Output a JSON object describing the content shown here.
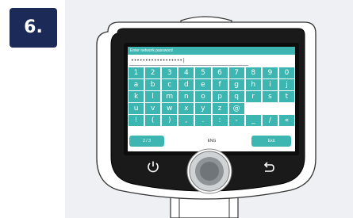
{
  "step": {
    "label": "6."
  },
  "screen": {
    "header": "Enter network password",
    "password_value": "••••••••••••••••••|",
    "keyboard_rows": [
      [
        "1",
        "2",
        "3",
        "4",
        "5",
        "6",
        "7",
        "8",
        "9",
        "0"
      ],
      [
        "a",
        "b",
        "c",
        "d",
        "e",
        "f",
        "g",
        "h",
        "i",
        "j"
      ],
      [
        "k",
        "l",
        "m",
        "n",
        "o",
        "p",
        "q",
        "r",
        "s",
        "t"
      ],
      [
        "u",
        "v",
        "w",
        "x",
        "y",
        "z",
        "@",
        "",
        "",
        ""
      ],
      [
        "!",
        "(",
        ")",
        ",",
        ".",
        ":",
        "-",
        "_",
        "/",
        "«"
      ]
    ],
    "page_label": "2 / 3",
    "language": "ENG",
    "exit_label": "Exit"
  },
  "hardware": {
    "power_icon": "power-icon",
    "back_icon": "back-arrow-icon",
    "dial": "jog-dial"
  },
  "colors": {
    "accent": "#3db5b0",
    "badge": "#1b2a57",
    "device_body": "#1a1a1a"
  }
}
